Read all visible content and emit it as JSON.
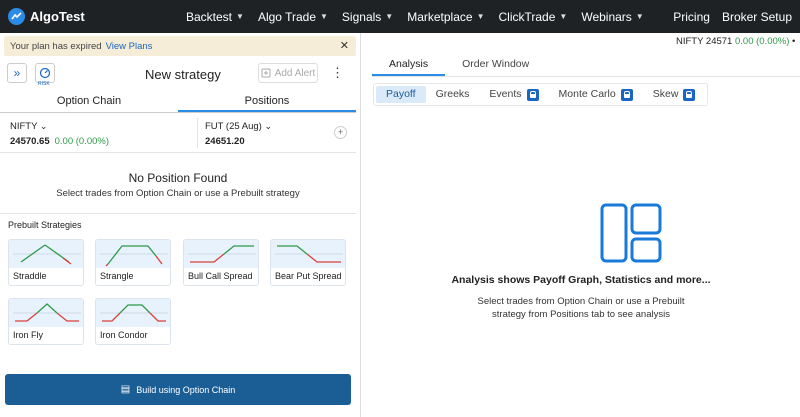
{
  "brand": {
    "name": "AlgoTest"
  },
  "nav": {
    "items": [
      {
        "label": "Backtest",
        "chevron": true
      },
      {
        "label": "Algo Trade",
        "chevron": true
      },
      {
        "label": "Signals",
        "chevron": true
      },
      {
        "label": "Marketplace",
        "chevron": true
      },
      {
        "label": "ClickTrade",
        "chevron": true
      },
      {
        "label": "Webinars",
        "chevron": true
      }
    ],
    "right": [
      {
        "label": "Pricing"
      },
      {
        "label": "Broker Setup"
      }
    ]
  },
  "banner": {
    "text": "Your plan has expired",
    "link": "View Plans",
    "close": "✕"
  },
  "strategy": {
    "title": "New strategy",
    "risk_label": "RISK",
    "add_alert": "Add Alert",
    "kebab": "⋮"
  },
  "left_tabs": [
    {
      "label": "Option Chain",
      "active": false
    },
    {
      "label": "Positions",
      "active": true
    }
  ],
  "quotes": {
    "nifty": {
      "symbol": "NIFTY",
      "value": "24570.65",
      "change": "0.00 (0.00%)"
    },
    "fut": {
      "symbol": "FUT (25 Aug)",
      "value": "24651.20"
    }
  },
  "no_position": {
    "heading": "No Position Found",
    "subtitle": "Select trades from Option Chain or use a Prebuilt strategy"
  },
  "prebuilt": {
    "title": "Prebuilt Strategies",
    "cards": [
      {
        "label": "Straddle",
        "shape": "straddle"
      },
      {
        "label": "Strangle",
        "shape": "strangle"
      },
      {
        "label": "Bull Call Spread",
        "shape": "bullcall"
      },
      {
        "label": "Bear Put Spread",
        "shape": "bearput"
      },
      {
        "label": "Iron Fly",
        "shape": "ironfly"
      },
      {
        "label": "Iron Condor",
        "shape": "ironcondor"
      }
    ]
  },
  "build_button": {
    "label": "Build using Option Chain"
  },
  "ticker": {
    "symbol": "NIFTY",
    "value": "24571",
    "change": "0.00 (0.00%)"
  },
  "right_tabs": [
    {
      "label": "Analysis",
      "active": true
    },
    {
      "label": "Order Window",
      "active": false
    }
  ],
  "sub_tabs": [
    {
      "label": "Payoff",
      "active": true,
      "locked": false
    },
    {
      "label": "Greeks",
      "active": false,
      "locked": false
    },
    {
      "label": "Events",
      "active": false,
      "locked": true
    },
    {
      "label": "Monte Carlo",
      "active": false,
      "locked": true
    },
    {
      "label": "Skew",
      "active": false,
      "locked": true
    }
  ],
  "analysis": {
    "heading": "Analysis shows Payoff Graph, Statistics and more...",
    "subtitle": "Select trades from Option Chain or use a Prebuilt strategy from Positions tab to see analysis"
  },
  "colors": {
    "nav_bg": "#1f2225",
    "accent": "#2b8ce6",
    "build_bg": "#1b5e95",
    "profit": "#2e9a4a",
    "loss": "#d9413a"
  }
}
